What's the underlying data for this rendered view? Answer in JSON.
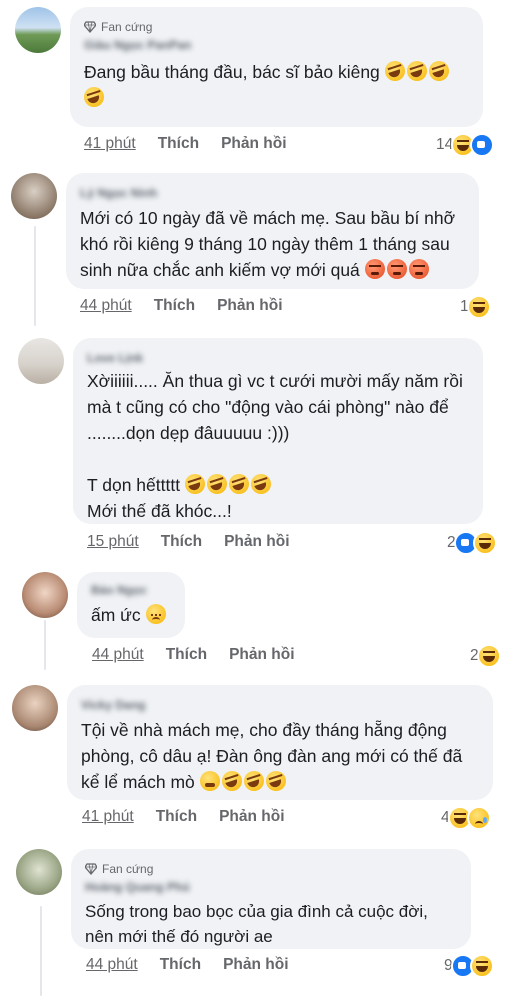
{
  "comments": [
    {
      "badge": "Fan cứng",
      "author": "Giàu Ngọc PanPan",
      "text": "Đang bầu tháng đầu, bác sĩ bảo kiêng ",
      "time": "41 phút",
      "like": "Thích",
      "reply": "Phản hồi",
      "reaction_count": "14",
      "reactions": [
        "haha",
        "like"
      ],
      "avatar_color": "#6b8f5a"
    },
    {
      "author": "Lý Ngọc Ninh",
      "text": "Mới có 10 ngày đã về mách mẹ. Sau bầu bí nhỡ khó rồi kiêng 9 tháng 10 ngày thêm 1 tháng sau sinh nữa chắc anh kiếm vợ mới quá ",
      "time": "44 phút",
      "like": "Thích",
      "reply": "Phản hồi",
      "reaction_count": "1",
      "reactions": [
        "haha"
      ],
      "avatar_color": "#9c8a7a"
    },
    {
      "author": "Love Lịnk",
      "text_lines": [
        "Xờiiiiii..... Ăn thua gì vc t cưới mười mấy năm rồi mà t cũng có cho \"động vào cái phòng\" nào để ........dọn dẹp đâuuuuu :)))",
        "",
        "T dọn hếttttt ",
        "Mới thế đã khóc...!"
      ],
      "time": "15 phút",
      "like": "Thích",
      "reply": "Phản hồi",
      "reaction_count": "2",
      "reactions": [
        "like",
        "haha"
      ],
      "avatar_color": "#c9c4bd"
    },
    {
      "author": "Bảo Ngọc",
      "text": "ấm ức ",
      "time": "44 phút",
      "like": "Thích",
      "reply": "Phản hồi",
      "reaction_count": "2",
      "reactions": [
        "haha"
      ],
      "avatar_color": "#c7a593"
    },
    {
      "author": "Vicky Dang",
      "text": "Tội về nhà mách mẹ, cho đầy tháng hẵng động phòng, cô dâu ạ! Đàn ông đàn ang mới có thế đã kể lể mách mò ",
      "time": "41 phút",
      "like": "Thích",
      "reply": "Phản hồi",
      "reaction_count": "4",
      "reactions": [
        "haha",
        "sad"
      ],
      "avatar_color": "#b79a88"
    },
    {
      "badge": "Fan cứng",
      "author": "Hoàng Quang Phú",
      "text": "Sống trong bao bọc của gia đình cả cuộc đời, nên mới thế đó người ae",
      "time": "44 phút",
      "like": "Thích",
      "reply": "Phản hồi",
      "reaction_count": "9",
      "reactions": [
        "like",
        "haha"
      ],
      "avatar_color": "#8f9a7e"
    }
  ]
}
